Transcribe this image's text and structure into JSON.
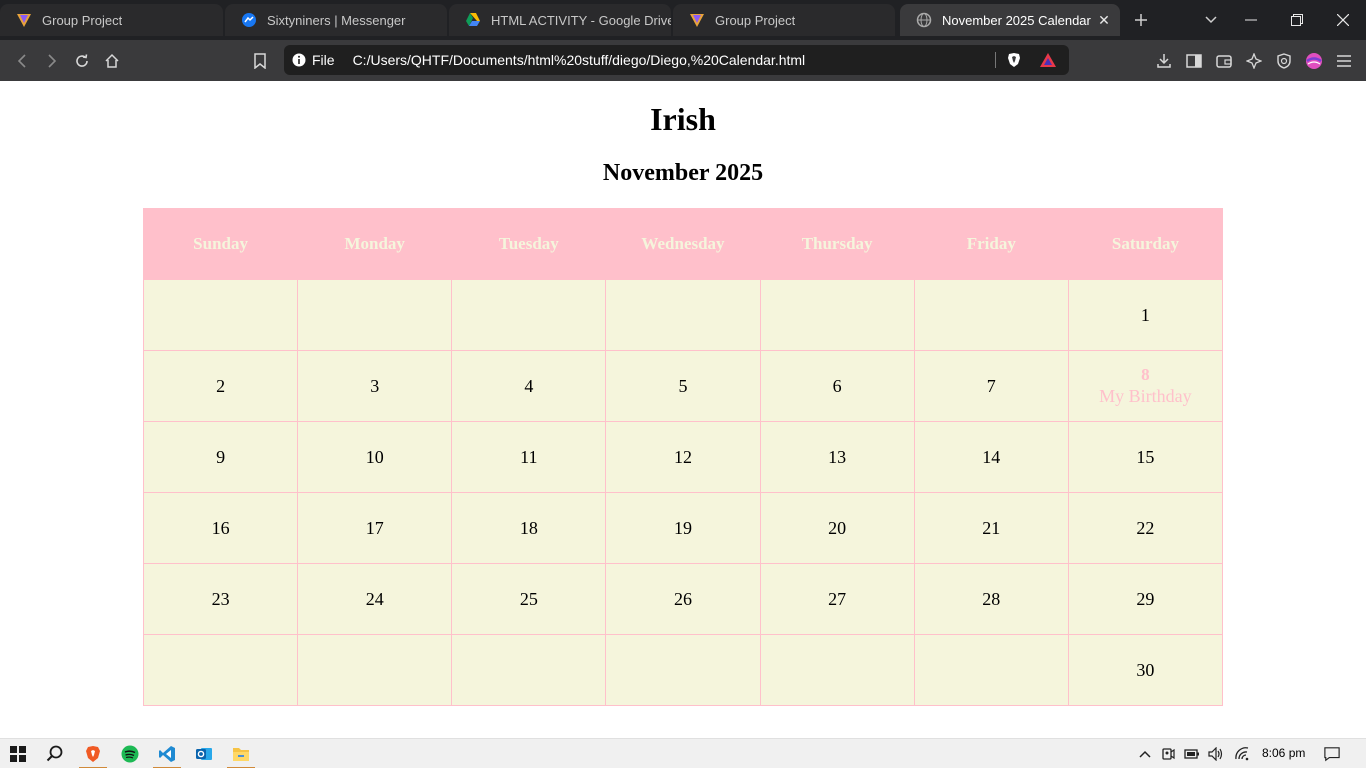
{
  "browser": {
    "tabs": [
      {
        "title": "Group Project",
        "icon": "vivaldi-logo-icon",
        "active": false
      },
      {
        "title": "Sixtyniners | Messenger",
        "icon": "messenger-icon",
        "active": false
      },
      {
        "title": "HTML ACTIVITY - Google Drive",
        "icon": "google-drive-icon",
        "active": false
      },
      {
        "title": "Group Project",
        "icon": "vivaldi-logo-icon",
        "active": false
      },
      {
        "title": "November 2025 Calendar",
        "icon": "globe-icon",
        "active": true
      }
    ],
    "address_bar": {
      "scheme_label": "File",
      "url": "C:/Users/QHTF/Documents/html%20stuff/diego/Diego,%20Calendar.html"
    }
  },
  "page": {
    "title": "Irish",
    "month_title": "November 2025",
    "weekdays": [
      "Sunday",
      "Monday",
      "Tuesday",
      "Wednesday",
      "Thursday",
      "Friday",
      "Saturday"
    ],
    "weeks": [
      [
        "",
        "",
        "",
        "",
        "",
        "",
        "1"
      ],
      [
        "2",
        "3",
        "4",
        "5",
        "6",
        "7",
        "8"
      ],
      [
        "9",
        "10",
        "11",
        "12",
        "13",
        "14",
        "15"
      ],
      [
        "16",
        "17",
        "18",
        "19",
        "20",
        "21",
        "22"
      ],
      [
        "23",
        "24",
        "25",
        "26",
        "27",
        "28",
        "29"
      ],
      [
        "",
        "",
        "",
        "",
        "",
        "",
        "30"
      ]
    ],
    "special_day": {
      "day": "8",
      "note": "My Birthday"
    },
    "colors": {
      "header_bg": "#ffc0cb",
      "header_text": "#f5f5dc",
      "cell_bg": "#f5f5dc",
      "border": "#ffc0cb",
      "special_text": "#ffc0cb"
    }
  },
  "taskbar": {
    "apps": [
      "start-icon",
      "search-icon",
      "brave-icon",
      "spotify-icon",
      "vscode-icon",
      "outlook-icon",
      "file-explorer-icon"
    ],
    "clock": "8:06 pm"
  }
}
